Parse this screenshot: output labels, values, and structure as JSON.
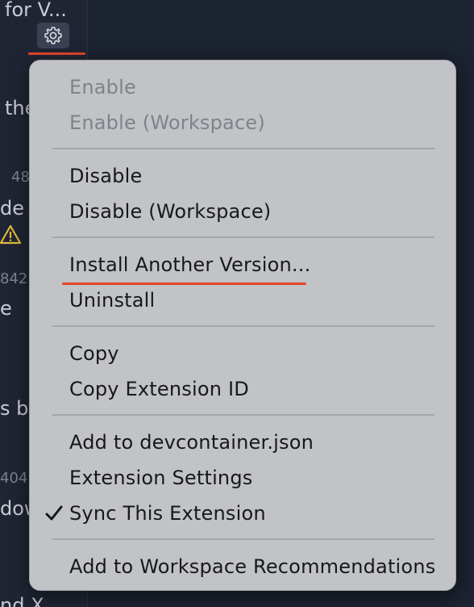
{
  "sidebar": {
    "fragments": [
      "for V...",
      "the",
      "48",
      "de",
      "842",
      "e",
      "s by",
      "404",
      "dow",
      "nd X"
    ]
  },
  "menu": {
    "items": [
      {
        "label": "Enable",
        "enabled": false
      },
      {
        "label": "Enable (Workspace)",
        "enabled": false
      },
      {
        "label": "Disable",
        "enabled": true
      },
      {
        "label": "Disable (Workspace)",
        "enabled": true
      },
      {
        "label": "Install Another Version...",
        "enabled": true
      },
      {
        "label": "Uninstall",
        "enabled": true
      },
      {
        "label": "Copy",
        "enabled": true
      },
      {
        "label": "Copy Extension ID",
        "enabled": true
      },
      {
        "label": "Add to devcontainer.json",
        "enabled": true
      },
      {
        "label": "Extension Settings",
        "enabled": true
      },
      {
        "label": "Sync This Extension",
        "enabled": true,
        "checked": true
      },
      {
        "label": "Add to Workspace Recommendations",
        "enabled": true
      }
    ]
  },
  "colors": {
    "highlight_underline": "#e5452b",
    "menu_background": "#c2c3c7",
    "page_background": "#1b2230"
  }
}
